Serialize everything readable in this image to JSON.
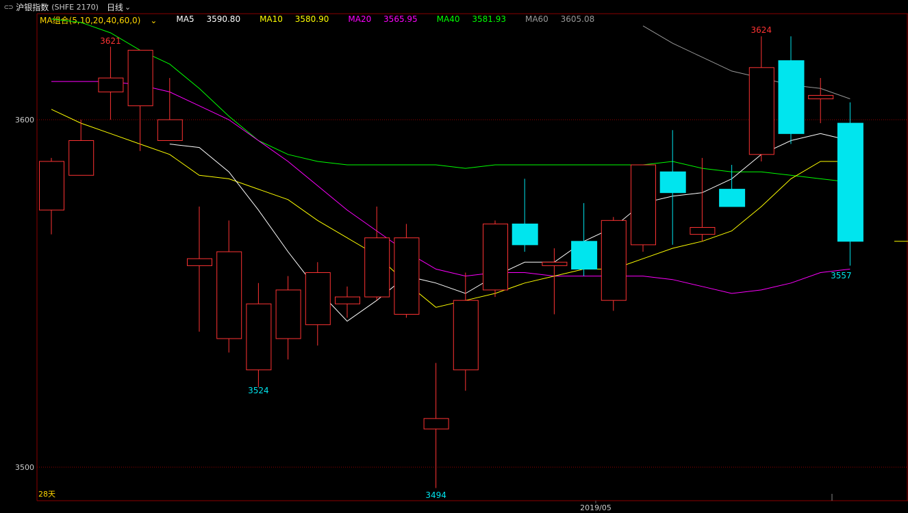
{
  "header": {
    "icon": "linked-window-icon",
    "icon_glyph": "⊂⊃",
    "title": "沪银指数",
    "code": "(SHFE 2170)",
    "period": "日线",
    "chevron": "⌄"
  },
  "legend": {
    "combo": "MA组合(5,10,20,40,60,0)",
    "combo_chevron": "⌄",
    "items": [
      {
        "label": "MA5",
        "value": "3590.80",
        "color": "#ffffff"
      },
      {
        "label": "MA10",
        "value": "3580.90",
        "color": "#ffff00"
      },
      {
        "label": "MA20",
        "value": "3565.95",
        "color": "#ff00ff"
      },
      {
        "label": "MA40",
        "value": "3581.93",
        "color": "#00ff00"
      },
      {
        "label": "MA60",
        "value": "3605.08",
        "color": "#999999"
      }
    ],
    "combo_color": "#ffd700"
  },
  "colors": {
    "up": "#ff3333",
    "down": "#00e5ee",
    "grid": "#990000",
    "frame": "#8b0000"
  },
  "chart_data": {
    "type": "candlestick",
    "y_ticks": [
      3600,
      3500
    ],
    "y_range": [
      3493,
      3627
    ],
    "x_label": "2019/05",
    "day_count_label": "28天",
    "high_label": "3621",
    "high2_label": "3624",
    "low_label": "3494",
    "low2_label": "3524",
    "last_low_label": "3557",
    "candles": [
      {
        "o": 3574,
        "h": 3589,
        "l": 3567,
        "c": 3588
      },
      {
        "o": 3584,
        "h": 3600,
        "l": 3584,
        "c": 3594
      },
      {
        "o": 3608,
        "h": 3621,
        "l": 3600,
        "c": 3612
      },
      {
        "o": 3604,
        "h": 3620,
        "l": 3591,
        "c": 3620
      },
      {
        "o": 3594,
        "h": 3612,
        "l": 3594,
        "c": 3600
      },
      {
        "o": 3558,
        "h": 3575,
        "l": 3539,
        "c": 3560
      },
      {
        "o": 3537,
        "h": 3571,
        "l": 3533,
        "c": 3562
      },
      {
        "o": 3528,
        "h": 3553,
        "l": 3523,
        "c": 3547
      },
      {
        "o": 3537,
        "h": 3555,
        "l": 3531,
        "c": 3551
      },
      {
        "o": 3541,
        "h": 3559,
        "l": 3535,
        "c": 3556
      },
      {
        "o": 3547,
        "h": 3552,
        "l": 3543,
        "c": 3549
      },
      {
        "o": 3549,
        "h": 3575,
        "l": 3548,
        "c": 3566
      },
      {
        "o": 3544,
        "h": 3570,
        "l": 3543,
        "c": 3566
      },
      {
        "o": 3511,
        "h": 3530,
        "l": 3494,
        "c": 3514
      },
      {
        "o": 3528,
        "h": 3556,
        "l": 3522,
        "c": 3548
      },
      {
        "o": 3551,
        "h": 3571,
        "l": 3549,
        "c": 3570
      },
      {
        "o": 3570,
        "h": 3583,
        "l": 3562,
        "c": 3564
      },
      {
        "o": 3558,
        "h": 3563,
        "l": 3544,
        "c": 3559
      },
      {
        "o": 3565,
        "h": 3576,
        "l": 3555,
        "c": 3557
      },
      {
        "o": 3548,
        "h": 3572,
        "l": 3545,
        "c": 3571
      },
      {
        "o": 3564,
        "h": 3584,
        "l": 3562,
        "c": 3587
      },
      {
        "o": 3585,
        "h": 3597,
        "l": 3564,
        "c": 3579
      },
      {
        "o": 3567,
        "h": 3589,
        "l": 3565,
        "c": 3569
      },
      {
        "o": 3580,
        "h": 3587,
        "l": 3577,
        "c": 3575
      },
      {
        "o": 3590,
        "h": 3624,
        "l": 3588,
        "c": 3615
      },
      {
        "o": 3617,
        "h": 3624,
        "l": 3593,
        "c": 3596
      },
      {
        "o": 3606,
        "h": 3612,
        "l": 3599,
        "c": 3607
      },
      {
        "o": 3599,
        "h": 3605,
        "l": 3558,
        "c": 3565
      }
    ],
    "ma5": [
      null,
      null,
      null,
      null,
      3593,
      3592,
      3585,
      3574,
      3562,
      3551,
      3542,
      3548,
      3555,
      3553,
      3550,
      3555,
      3559,
      3559,
      3565,
      3569,
      3576,
      3578,
      3579,
      3583,
      3590,
      3594,
      3596,
      3594
    ],
    "ma10": [
      3603,
      3599,
      3596,
      3593,
      3590,
      3584,
      3583,
      3580,
      3577,
      3571,
      3566,
      3561,
      3553,
      3546,
      3548,
      3550,
      3553,
      3555,
      3557,
      3557,
      3560,
      3563,
      3565,
      3568,
      3575,
      3583,
      3588,
      3588
    ],
    "ma20": [
      3611,
      3611,
      3611,
      3610,
      3608,
      3604,
      3600,
      3594,
      3588,
      3581,
      3574,
      3568,
      3562,
      3557,
      3555,
      3556,
      3556,
      3555,
      3555,
      3555,
      3555,
      3554,
      3552,
      3550,
      3551,
      3553,
      3556,
      3557
    ],
    "ma40": [
      3629,
      3628,
      3625,
      3620,
      3616,
      3609,
      3601,
      3594,
      3590,
      3588,
      3587,
      3587,
      3587,
      3587,
      3586,
      3587,
      3587,
      3587,
      3587,
      3587,
      3587,
      3588,
      3586,
      3585,
      3585,
      3584,
      3583,
      3582
    ],
    "ma60": [
      null,
      null,
      null,
      null,
      null,
      null,
      null,
      null,
      null,
      null,
      null,
      null,
      null,
      null,
      null,
      null,
      null,
      null,
      null,
      null,
      3627,
      3622,
      3618,
      3614,
      3612,
      3610,
      3609,
      3606
    ],
    "pointer_value": 3565
  }
}
